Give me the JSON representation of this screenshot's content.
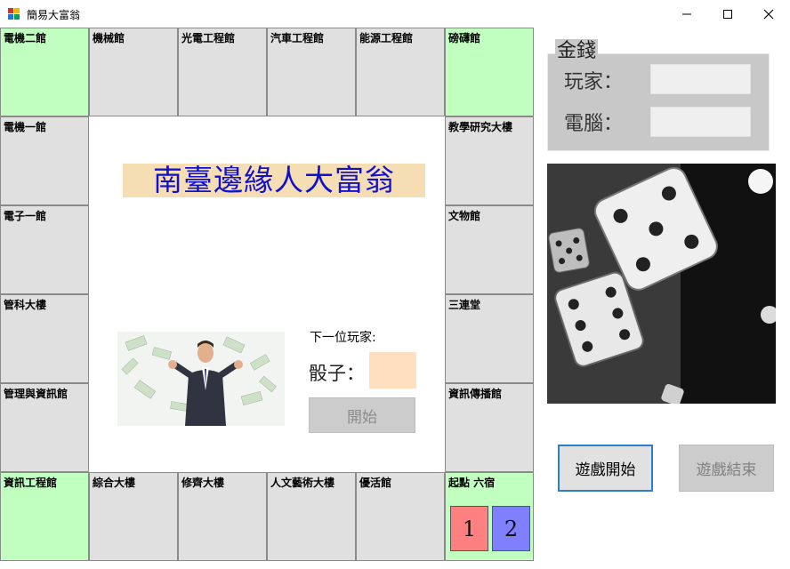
{
  "window": {
    "title": "簡易大富翁",
    "controls": [
      "minimize-icon",
      "maximize-icon",
      "close-icon"
    ]
  },
  "board": {
    "top": [
      "電機二館",
      "機械館",
      "光電工程館",
      "汽車工程館",
      "能源工程館",
      "磅礴館"
    ],
    "left": [
      "電機一館",
      "電子一館",
      "管科大樓",
      "管理與資訊館"
    ],
    "right": [
      "教學研究大樓",
      "文物館",
      "三連堂",
      "資訊傳播館"
    ],
    "bottom": [
      "資訊工程館",
      "綜合大樓",
      "修齊大樓",
      "人文藝術大樓",
      "優活館",
      "起點 六宿"
    ]
  },
  "center": {
    "title": "南臺邊緣人大富翁",
    "next_player_label": "下一位玩家:",
    "dice_label": "骰子：",
    "dice_value": "",
    "start_button": "開始"
  },
  "tokens": [
    {
      "label": "1",
      "color": "#ff8080"
    },
    {
      "label": "2",
      "color": "#8080ff"
    }
  ],
  "money": {
    "legend": "金錢",
    "player_label": "玩家：",
    "player_value": "",
    "computer_label": "電腦：",
    "computer_value": ""
  },
  "buttons": {
    "game_start": "遊戲開始",
    "game_end": "遊戲結束"
  },
  "colors": {
    "corner_green": "#c0ffc0",
    "cell_gray": "#e0e0e0",
    "title_blue": "#1010d0",
    "title_bg": "#f5deb3",
    "dice_box": "#ffdfc0",
    "accent": "#2b7fd0"
  }
}
